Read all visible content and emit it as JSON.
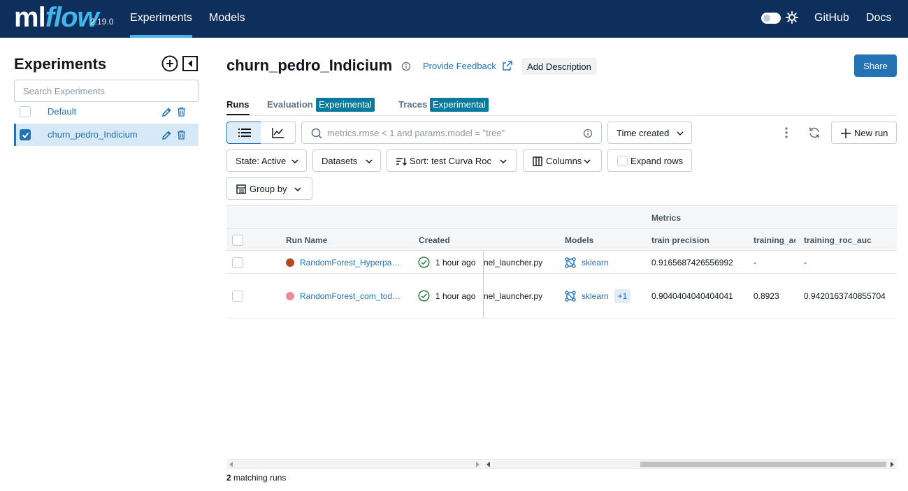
{
  "topbar": {
    "logo_ml": "ml",
    "logo_flow": "flow",
    "version": "2.19.0",
    "nav": [
      "Experiments",
      "Models"
    ],
    "github": "GitHub",
    "docs": "Docs",
    "accent": "#43b5e8",
    "bg": "#0e2f5c"
  },
  "sidebar": {
    "title": "Experiments",
    "search_placeholder": "Search Experiments",
    "items": [
      {
        "label": "Default",
        "selected": false
      },
      {
        "label": "churn_pedro_Indicium",
        "selected": true
      }
    ]
  },
  "header": {
    "title": "churn_pedro_Indicium",
    "feedback": "Provide Feedback",
    "add_description": "Add Description",
    "share": "Share"
  },
  "tabs": {
    "runs": "Runs",
    "evaluation": "Evaluation",
    "traces": "Traces",
    "badge": "Experimental"
  },
  "toolbar": {
    "search_placeholder": "metrics.rmse < 1 and params.model = \"tree\"",
    "time_created": "Time created",
    "new_run": "New run",
    "state": "State: Active",
    "datasets": "Datasets",
    "sort": "Sort: test Curva Roc",
    "columns": "Columns",
    "expand_rows": "Expand rows",
    "group_by": "Group by"
  },
  "table": {
    "group_header": "Metrics",
    "columns": [
      "Run Name",
      "Created",
      "Models",
      "train precision",
      "training_ac",
      "training_roc_auc"
    ],
    "rows": [
      {
        "dot_color": "#b34a23",
        "name": "RandomForest_Hyperpa…",
        "created": "1 hour ago",
        "source": "nel_launcher.py",
        "model": "sklearn",
        "extra_models": "",
        "train_precision": "0.9165687426556992",
        "training_ac": "-",
        "training_roc_auc": "-"
      },
      {
        "dot_color": "#ec8a9c",
        "name": "RandomForest_com_tod…",
        "created": "1 hour ago",
        "source": "nel_launcher.py",
        "model": "sklearn",
        "extra_models": "+1",
        "train_precision": "0.9040404040404041",
        "training_ac": "0.8923",
        "training_roc_auc": "0.9420163740855704"
      }
    ]
  },
  "footer": {
    "count": "2",
    "count_label": "matching runs"
  }
}
